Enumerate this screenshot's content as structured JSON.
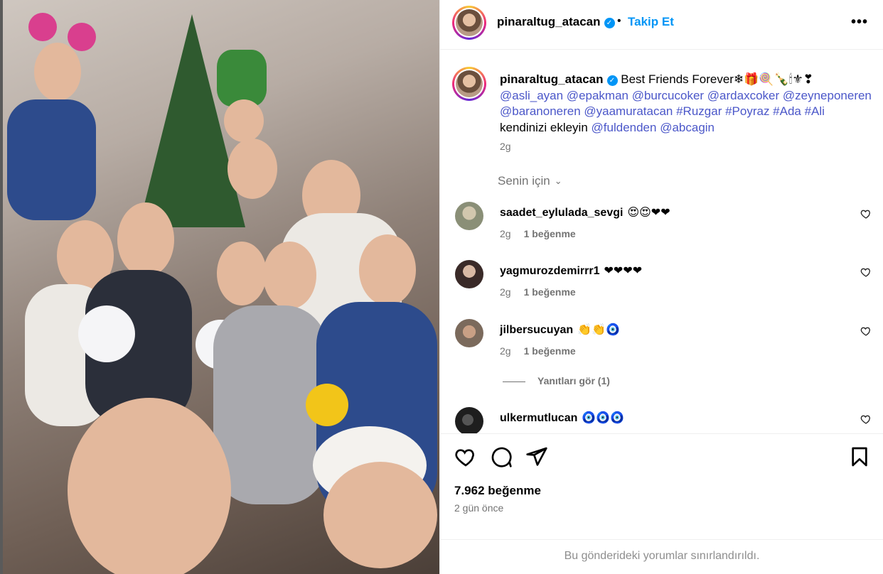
{
  "post": {
    "username": "pinaraltug_atacan",
    "follow_label": "Takip Et",
    "separator": "•",
    "more_label": "•••",
    "verified_glyph": "✓"
  },
  "caption": {
    "username": "pinaraltug_atacan",
    "text": "Best Friends Forever",
    "emojis": "❄🎁🍭🍾🕯⚜❣",
    "mentions_line1": "@asli_ayan @epakman @burcucoker @ardaxcoker @zeyneponeren",
    "mentions_line2": "@baranoneren @yaamuratacan #Ruzgar #Poyraz #Ada #Ali",
    "plain": "kendinizi ekleyin",
    "mentions_line3": "@fuldenden @abcagin",
    "time": "2g"
  },
  "sort_label": "Senin için",
  "comments": [
    {
      "username": "saadet_eylulada_sevgi",
      "text": "😍😍❤❤",
      "time": "2g",
      "likes": "1 beğenme",
      "avatar_color": "#8a8f77"
    },
    {
      "username": "yagmurozdemirrr1",
      "text": "❤❤❤❤",
      "time": "2g",
      "likes": "1 beğenme",
      "avatar_color": "#3a2a28"
    },
    {
      "username": "jilbersucuyan",
      "text": "👏👏🧿",
      "time": "2g",
      "likes": "1 beğenme",
      "avatar_color": "#7b6a5c"
    },
    {
      "username": "ulkermutlucan",
      "text": "🧿🧿🧿",
      "time": "",
      "likes": "",
      "avatar_color": "#1e1e1e"
    }
  ],
  "replies_label": "Yanıtları gör (1)",
  "likes_count": "7.962 beğenme",
  "posted_ago": "2 gün önce",
  "restricted_notice": "Bu gönderideki yorumlar sınırlandırıldı.",
  "icons": {
    "like": "heart-icon",
    "comment": "comment-icon",
    "share": "share-icon",
    "save": "bookmark-icon"
  },
  "colors": {
    "link": "#4b57c9",
    "follow": "#0095f6",
    "muted": "#737373"
  }
}
